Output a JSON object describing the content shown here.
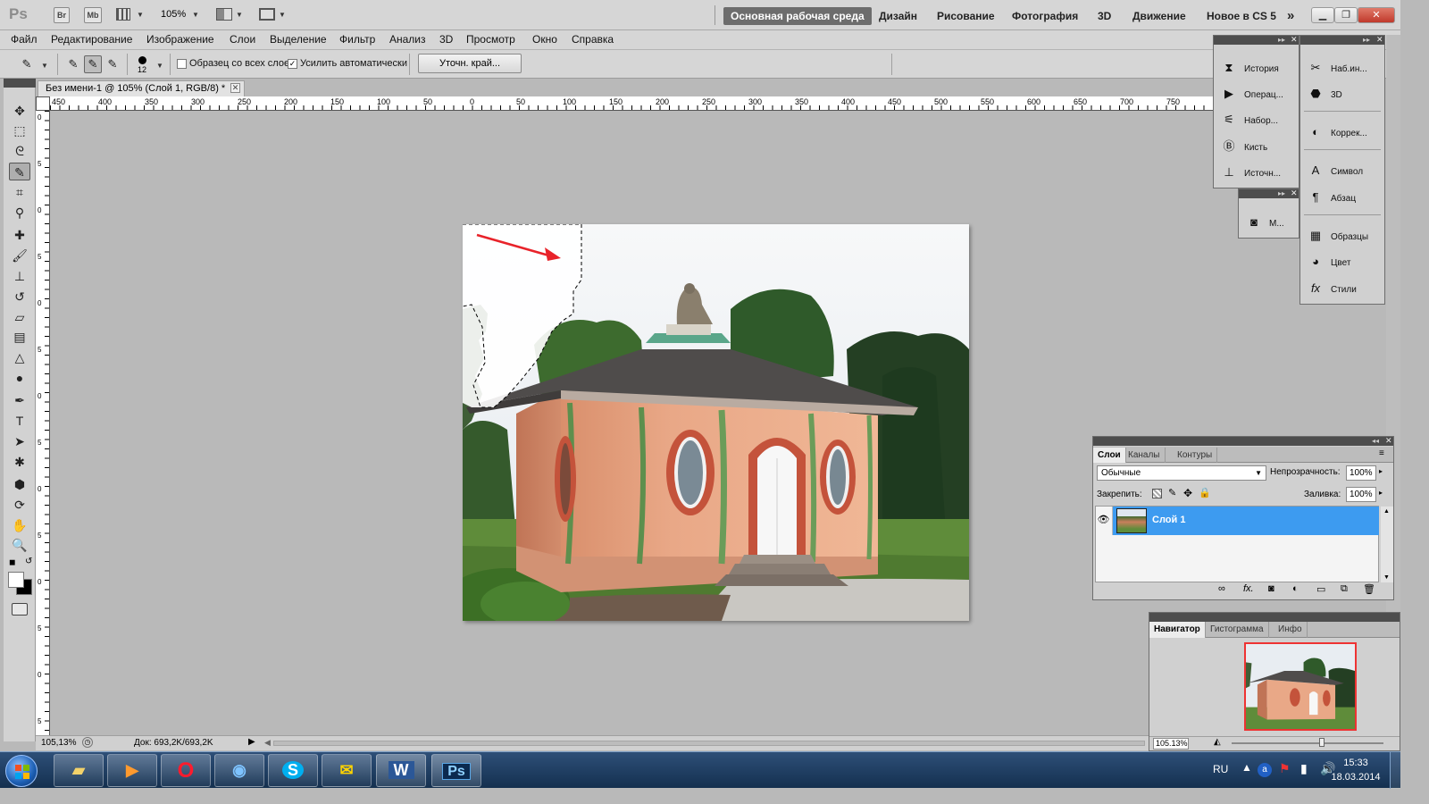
{
  "app": {
    "logo": "Ps",
    "bridge_label": "Br",
    "minibridge_label": "Mb",
    "zoom": "105%",
    "workspaces": [
      "Основная рабочая среда",
      "Дизайн",
      "Рисование",
      "Фотография",
      "3D",
      "Движение",
      "Новое в CS 5"
    ],
    "more_workspaces": "»"
  },
  "menu": [
    "Файл",
    "Редактирование",
    "Изображение",
    "Слои",
    "Выделение",
    "Фильтр",
    "Анализ",
    "3D",
    "Просмотр",
    "Окно",
    "Справка"
  ],
  "options": {
    "brush_size": "12",
    "sample_all_layers": "Образец со всех слоев",
    "auto_enhance": "Усилить автоматически",
    "refine_edge": "Уточн. край...",
    "sample_all_checked": false,
    "auto_enhance_checked": true
  },
  "document": {
    "tab_title": "Без имени-1 @ 105% (Слой 1, RGB/8) *",
    "ruler_h": [
      "450",
      "400",
      "350",
      "300",
      "250",
      "200",
      "150",
      "100",
      "50",
      "0",
      "50",
      "100",
      "150",
      "200",
      "250",
      "300",
      "350",
      "400",
      "450",
      "500",
      "550",
      "600",
      "650",
      "700",
      "750",
      "800"
    ],
    "ruler_v": [
      "0",
      "5",
      "0",
      "5",
      "0",
      "5",
      "0",
      "5",
      "0",
      "5",
      "0",
      "5",
      "0",
      "5"
    ],
    "zoom_status": "105,13%",
    "doc_size": "Док: 693,2K/693,2K"
  },
  "panels_mini_left": [
    "История",
    "Операц...",
    "Набор...",
    "Кисть",
    "Источн..."
  ],
  "panel_mask": "М...",
  "panels_mini_right": [
    "Наб.ин...",
    "3D",
    "Коррек...",
    "Символ",
    "Абзац",
    "Образцы",
    "Цвет",
    "Стили"
  ],
  "layers": {
    "tabs": [
      "Слои",
      "Каналы",
      "Контуры"
    ],
    "blend_mode": "Обычные",
    "opacity_label": "Непрозрачность:",
    "opacity": "100%",
    "lock_label": "Закрепить:",
    "fill_label": "Заливка:",
    "fill": "100%",
    "layer_name": "Слой 1",
    "footer_fx": "fx."
  },
  "navigator": {
    "tabs": [
      "Навигатор",
      "Гистограмма",
      "Инфо"
    ],
    "zoom": "105.13%"
  },
  "taskbar": {
    "lang": "RU",
    "time": "15:33",
    "date": "18.03.2014",
    "apps": [
      "explorer",
      "media-player",
      "opera",
      "chrome",
      "skype",
      "messenger",
      "word",
      "photoshop"
    ],
    "word_label": "W",
    "ps_label": "Ps"
  },
  "colors": {
    "selected_layer": "#3d9bf0",
    "accent_red": "#e8232a",
    "taskbar": "#1d3b5f"
  }
}
